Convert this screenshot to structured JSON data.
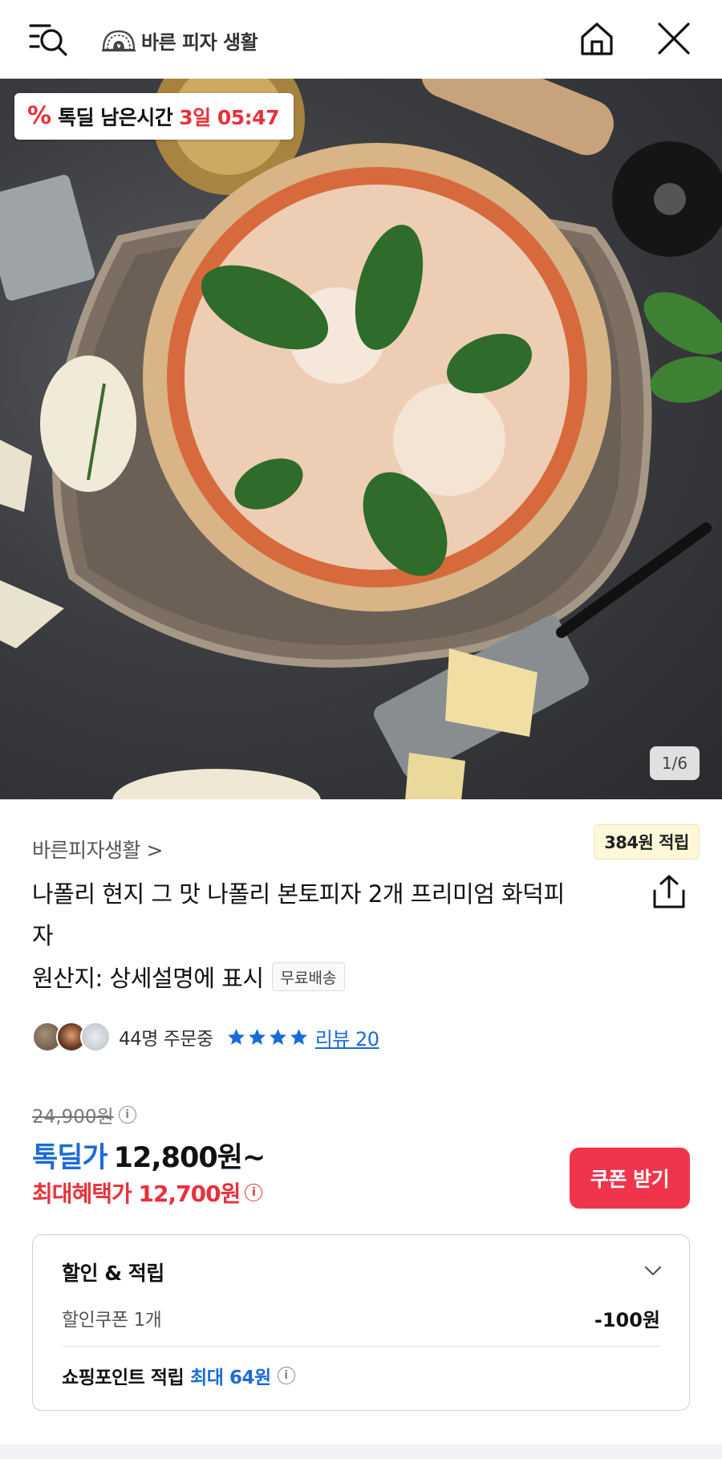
{
  "header": {
    "store_name": "바른 피자 생활"
  },
  "hero": {
    "deal_timer": {
      "icon": "%",
      "label": "톡딜 남은시간",
      "time": "3일 05:47"
    },
    "image_counter": "1/6"
  },
  "product": {
    "store_link": "바른피자생활 >",
    "point_badge": "384원 적립",
    "title": "나폴리 현지 그 맛 나폴리 본토피자 2개 프리미엄 화덕피자",
    "origin": "원산지: 상세설명에 표시",
    "free_shipping": "무료배송",
    "order_count": "44명 주문중",
    "rating_stars": 4,
    "review_link": "리뷰 20"
  },
  "pricing": {
    "original_price": "24,900원",
    "deal_label": "톡딜가",
    "deal_price": "12,800원~",
    "max_benefit": "최대혜택가 12,700원",
    "coupon_button": "쿠폰 받기",
    "info_glyph": "i"
  },
  "benefits": {
    "title": "할인 & 적립",
    "coupon_label": "할인쿠폰 1개",
    "coupon_value": "-100원",
    "points_label": "쇼핑포인트 적립",
    "points_value": "최대 64원"
  },
  "colors": {
    "accent_blue": "#1a6bd8",
    "accent_red": "#e8313a",
    "coupon_button": "#f0344b"
  }
}
